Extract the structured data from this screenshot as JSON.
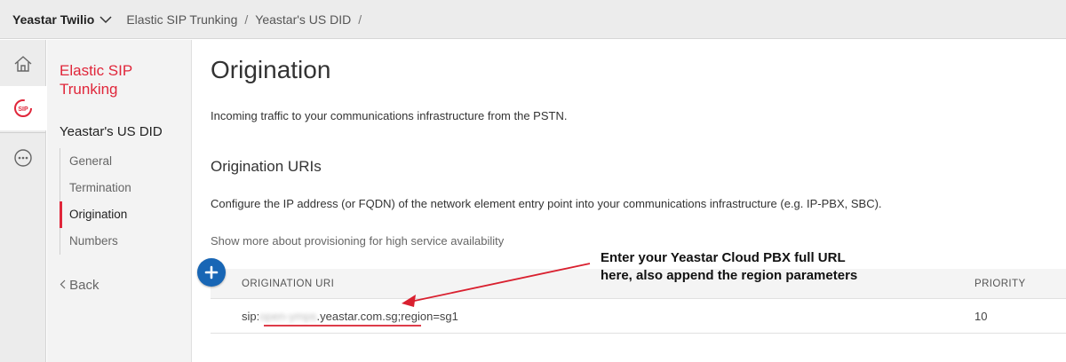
{
  "topbar": {
    "account_name": "Yeastar Twilio",
    "breadcrumb_1": "Elastic SIP Trunking",
    "separator_1": "/",
    "breadcrumb_2": "Yeastar's US DID",
    "separator_2": "/"
  },
  "rail": {
    "items": [
      {
        "name": "home",
        "icon": "home-icon"
      },
      {
        "name": "sip",
        "icon": "sip-icon",
        "label": "SIP"
      },
      {
        "name": "more",
        "icon": "more-icon"
      }
    ],
    "accent_color": "#e0263a"
  },
  "subnav": {
    "title": "Elastic SIP Trunking",
    "trunk_name": "Yeastar's US DID",
    "items": [
      {
        "label": "General",
        "active": false
      },
      {
        "label": "Termination",
        "active": false
      },
      {
        "label": "Origination",
        "active": true
      },
      {
        "label": "Numbers",
        "active": false
      }
    ],
    "back_label": "Back",
    "back_icon": "chevron-left-icon"
  },
  "main": {
    "title": "Origination",
    "description": "Incoming traffic to your communications infrastructure from the PSTN.",
    "section_title": "Origination URIs",
    "section_description": "Configure the IP address (or FQDN) of the network element entry point into your communications infrastructure (e.g. IP-PBX, SBC).",
    "show_more": "Show more about provisioning for high service availability",
    "table": {
      "columns": [
        "ORIGINATION URI",
        "PRIORITY"
      ],
      "rows": [
        {
          "uri_prefix": "sip:",
          "uri_hidden": "open-ymps",
          "uri_domain": ".yeastar.com.sg",
          "uri_params": ";region=sg1",
          "priority": "10"
        }
      ]
    },
    "add_button_color": "#1866b5"
  },
  "annotation": {
    "line_1": "Enter your Yeastar Cloud PBX full URL",
    "line_2": "here, also append the region parameters",
    "color": "#d9202f"
  }
}
